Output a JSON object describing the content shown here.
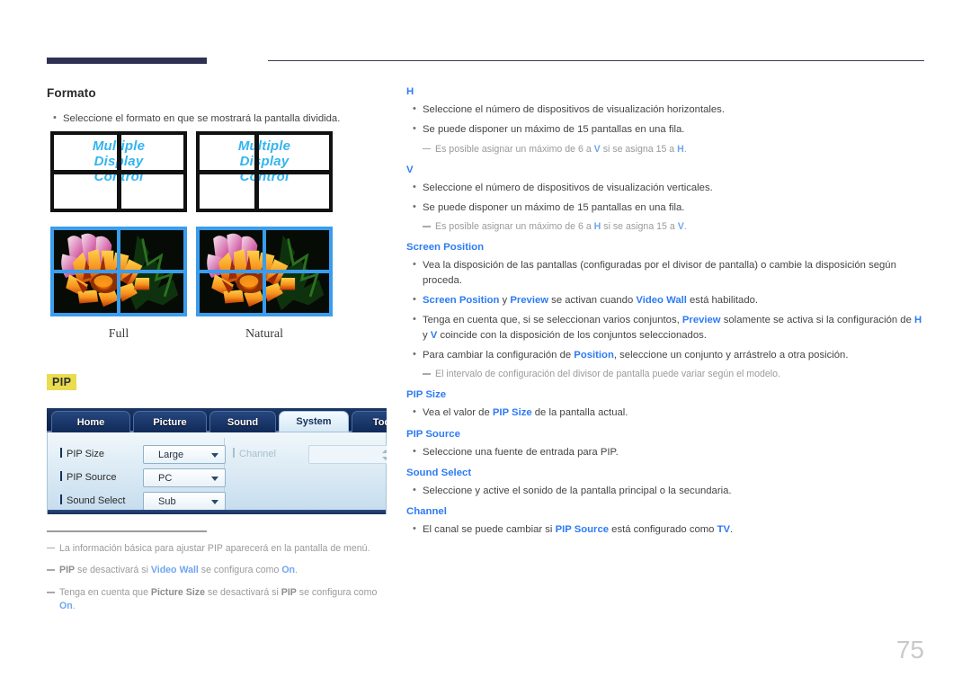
{
  "page": {
    "number": "75",
    "header_accent_color": "#2e3152"
  },
  "left_column": {
    "section_title": "Formato",
    "bullets": [
      "Seleccione el formato en que se mostrará la pantalla dividida."
    ],
    "illustrations": {
      "display_text_lines": [
        "Multiple",
        "Display",
        "Control"
      ],
      "captions": [
        "Full",
        "Natural"
      ]
    },
    "pip_badge": "PIP",
    "osd": {
      "tabs": [
        "Home",
        "Picture",
        "Sound",
        "System",
        "Tool"
      ],
      "active_tab": "System",
      "fields": [
        {
          "label": "PIP Size",
          "value": "Large",
          "disabled": false
        },
        {
          "label": "PIP Source",
          "value": "PC",
          "disabled": false
        },
        {
          "label": "Sound Select",
          "value": "Sub",
          "disabled": false
        }
      ],
      "right_field": {
        "label": "Channel",
        "value": "",
        "disabled": true
      }
    },
    "footnotes": [
      {
        "parts": [
          {
            "t": "La información básica para ajustar PIP aparecerá en la pantalla de menú.",
            "s": "plain"
          }
        ]
      },
      {
        "parts": [
          {
            "t": "PIP",
            "s": "dark"
          },
          {
            "t": " se desactivará si ",
            "s": "plain"
          },
          {
            "t": "Video Wall",
            "s": "blue"
          },
          {
            "t": " se configura como ",
            "s": "plain"
          },
          {
            "t": "On",
            "s": "blue"
          },
          {
            "t": ".",
            "s": "plain"
          }
        ]
      },
      {
        "parts": [
          {
            "t": "Tenga en cuenta que ",
            "s": "plain"
          },
          {
            "t": "Picture Size",
            "s": "dark"
          },
          {
            "t": " se desactivará si ",
            "s": "plain"
          },
          {
            "t": "PIP",
            "s": "dark"
          },
          {
            "t": " se configura como ",
            "s": "plain"
          },
          {
            "t": "On",
            "s": "blue"
          },
          {
            "t": ".",
            "s": "plain"
          }
        ]
      }
    ]
  },
  "right_column": {
    "blocks": [
      {
        "heading": "H",
        "bullets": [
          [
            {
              "t": "Seleccione el número de dispositivos de visualización horizontales.",
              "s": "plain"
            }
          ],
          [
            {
              "t": "Se puede disponer un máximo de 15 pantallas en una fila.",
              "s": "plain"
            }
          ]
        ],
        "notes": [
          [
            {
              "t": "Es posible asignar un máximo de 6 a ",
              "s": "plain"
            },
            {
              "t": "V",
              "s": "blue"
            },
            {
              "t": " si se asigna 15 a ",
              "s": "plain"
            },
            {
              "t": "H",
              "s": "blue"
            },
            {
              "t": ".",
              "s": "plain"
            }
          ]
        ]
      },
      {
        "heading": "V",
        "bullets": [
          [
            {
              "t": "Seleccione el número de dispositivos de visualización verticales.",
              "s": "plain"
            }
          ],
          [
            {
              "t": "Se puede disponer un máximo de 15 pantallas en una fila.",
              "s": "plain"
            }
          ]
        ],
        "notes": [
          [
            {
              "t": "Es posible asignar un máximo de 6 a ",
              "s": "plain"
            },
            {
              "t": "H",
              "s": "blue"
            },
            {
              "t": " si se asigna 15 a ",
              "s": "plain"
            },
            {
              "t": "V",
              "s": "blue"
            },
            {
              "t": ".",
              "s": "plain"
            }
          ]
        ]
      },
      {
        "heading": "Screen Position",
        "bullets": [
          [
            {
              "t": "Vea la disposición de las pantallas (configuradas por el divisor de pantalla) o cambie la disposición según proceda.",
              "s": "plain"
            }
          ],
          [
            {
              "t": "Screen Position",
              "s": "blue"
            },
            {
              "t": " y ",
              "s": "plain"
            },
            {
              "t": "Preview",
              "s": "blue"
            },
            {
              "t": " se activan cuando ",
              "s": "plain"
            },
            {
              "t": "Video Wall",
              "s": "blue"
            },
            {
              "t": " está habilitado.",
              "s": "plain"
            }
          ],
          [
            {
              "t": "Tenga en cuenta que, si se seleccionan varios conjuntos, ",
              "s": "plain"
            },
            {
              "t": "Preview",
              "s": "blue"
            },
            {
              "t": " solamente se activa si la configuración de ",
              "s": "plain"
            },
            {
              "t": "H",
              "s": "blue"
            },
            {
              "t": " y ",
              "s": "plain"
            },
            {
              "t": "V",
              "s": "blue"
            },
            {
              "t": " coincide con la disposición de los conjuntos seleccionados.",
              "s": "plain"
            }
          ],
          [
            {
              "t": "Para cambiar la configuración de ",
              "s": "plain"
            },
            {
              "t": "Position",
              "s": "blue"
            },
            {
              "t": ", seleccione un conjunto y arrástrelo a otra posición.",
              "s": "plain"
            }
          ]
        ],
        "notes": [
          [
            {
              "t": "El intervalo de configuración del divisor de pantalla puede variar según el modelo.",
              "s": "plain"
            }
          ]
        ]
      },
      {
        "heading": "PIP Size",
        "bullets": [
          [
            {
              "t": "Vea el valor de ",
              "s": "plain"
            },
            {
              "t": "PIP Size",
              "s": "blue"
            },
            {
              "t": " de la pantalla actual.",
              "s": "plain"
            }
          ]
        ],
        "notes": []
      },
      {
        "heading": "PIP Source",
        "bullets": [
          [
            {
              "t": "Seleccione una fuente de entrada para PIP.",
              "s": "plain"
            }
          ]
        ],
        "notes": []
      },
      {
        "heading": "Sound Select",
        "bullets": [
          [
            {
              "t": "Seleccione y active el sonido de la pantalla principal o la secundaria.",
              "s": "plain"
            }
          ]
        ],
        "notes": []
      },
      {
        "heading": "Channel",
        "bullets": [
          [
            {
              "t": "El canal se puede cambiar si ",
              "s": "plain"
            },
            {
              "t": "PIP Source",
              "s": "blue"
            },
            {
              "t": " está configurado como ",
              "s": "plain"
            },
            {
              "t": "TV",
              "s": "blue"
            },
            {
              "t": ".",
              "s": "plain"
            }
          ]
        ],
        "notes": []
      }
    ]
  }
}
